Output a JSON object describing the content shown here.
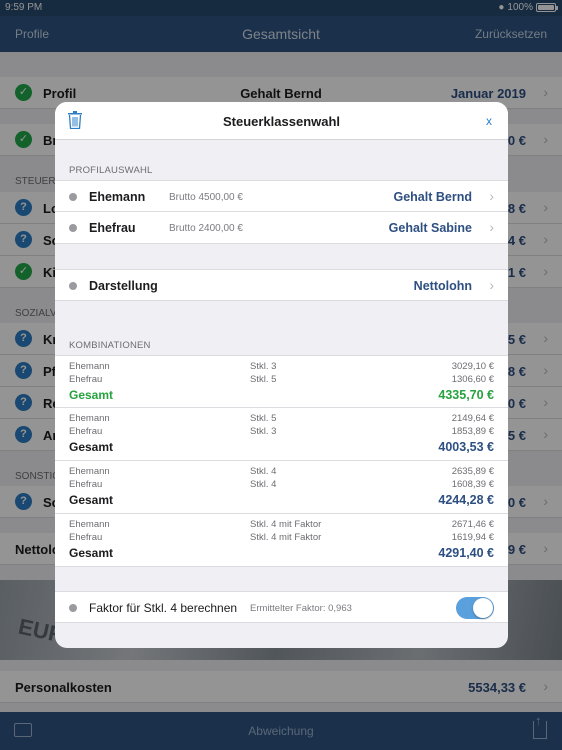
{
  "status": {
    "time": "9:59 PM",
    "battery": "100%"
  },
  "nav": {
    "left": "Profile",
    "title": "Gesamtsicht",
    "right": "Zurücksetzen"
  },
  "background": {
    "profil_label": "Profil",
    "profil_mid": "Gehalt Bernd",
    "profil_value": "Januar 2019",
    "row2_label": "Br",
    "row2_value": "0 €",
    "sec_steuer": "STEUERN",
    "rows_steuer": [
      {
        "label": "Lo",
        "value": "8 €"
      },
      {
        "label": "So",
        "value": "4 €"
      },
      {
        "label": "Ki",
        "value": "51 €"
      }
    ],
    "sec_sozial": "SOZIALV",
    "rows_sozial": [
      {
        "label": "Kr",
        "value": "75 €"
      },
      {
        "label": "Pf",
        "value": "8 €"
      },
      {
        "label": "Re",
        "value": "60 €"
      },
      {
        "label": "Ar",
        "value": "25 €"
      }
    ],
    "sec_sonst": "SONSTIG",
    "row_sonst": {
      "label": "So",
      "value": "0 €"
    },
    "netto_label": "Nettolo",
    "netto_value": "9 €",
    "euro_text": "EURO",
    "personal_label": "Personalkosten",
    "personal_value": "5534,33 €"
  },
  "toolbar": {
    "center": "Abweichung"
  },
  "modal": {
    "title": "Steuerklassenwahl",
    "close": "x",
    "section_profil": "PROFILAUSWAHL",
    "profiles": [
      {
        "name": "Ehemann",
        "brutto": "Brutto 4500,00 €",
        "value": "Gehalt Bernd"
      },
      {
        "name": "Ehefrau",
        "brutto": "Brutto 2400,00 €",
        "value": "Gehalt Sabine"
      }
    ],
    "darstellung": {
      "name": "Darstellung",
      "value": "Nettolohn"
    },
    "section_kombi": "KOMBINATIONEN",
    "combos": [
      {
        "p1": "Ehemann",
        "k1": "Stkl. 3",
        "v1": "3029,10 €",
        "p2": "Ehefrau",
        "k2": "Stkl. 5",
        "v2": "1306,60 €",
        "label": "Gesamt",
        "total": "4335,70 €"
      },
      {
        "p1": "Ehemann",
        "k1": "Stkl. 5",
        "v1": "2149,64 €",
        "p2": "Ehefrau",
        "k2": "Stkl. 3",
        "v2": "1853,89 €",
        "label": "Gesamt",
        "total": "4003,53 €"
      },
      {
        "p1": "Ehemann",
        "k1": "Stkl. 4",
        "v1": "2635,89 €",
        "p2": "Ehefrau",
        "k2": "Stkl. 4",
        "v2": "1608,39 €",
        "label": "Gesamt",
        "total": "4244,28 €"
      },
      {
        "p1": "Ehemann",
        "k1": "Stkl. 4 mit Faktor",
        "v1": "2671,46 €",
        "p2": "Ehefrau",
        "k2": "Stkl. 4 mit Faktor",
        "v2": "1619,94 €",
        "label": "Gesamt",
        "total": "4291,40 €"
      }
    ],
    "faktor": {
      "label": "Faktor für Stkl. 4 berechnen",
      "info": "Ermittelter Faktor: 0,963",
      "enabled": true
    }
  },
  "colors": {
    "nav": "#2d5482",
    "accent": "#2c7fc4",
    "value": "#2d4f82",
    "best": "#27a23f",
    "ok": "#22a84b"
  }
}
